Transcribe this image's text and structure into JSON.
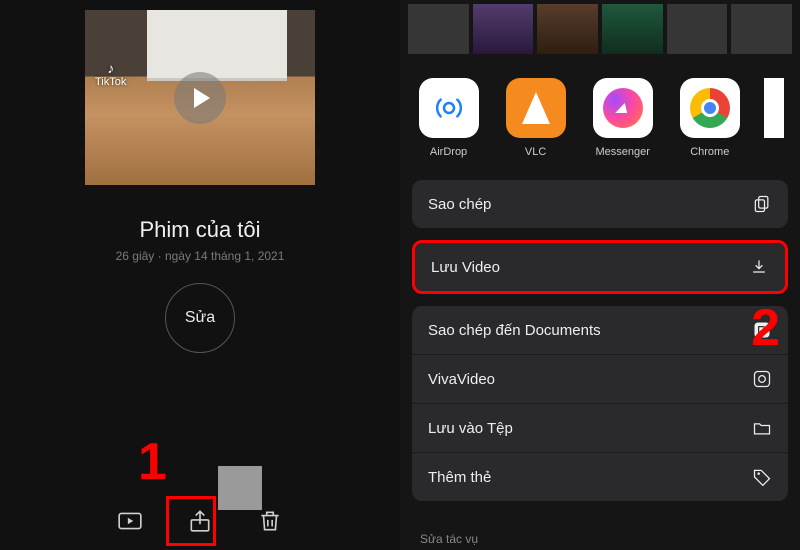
{
  "left": {
    "watermark": "TikTok",
    "title": "Phim của tôi",
    "subtitle": "26 giây · ngày 14 tháng 1, 2021",
    "edit_label": "Sửa"
  },
  "callouts": {
    "one": "1",
    "two": "2"
  },
  "share": {
    "apps": [
      {
        "name": "AirDrop"
      },
      {
        "name": "VLC"
      },
      {
        "name": "Messenger"
      },
      {
        "name": "Chrome"
      }
    ],
    "actions": {
      "copy": "Sao chép",
      "save_video": "Lưu Video",
      "copy_to_docs": "Sao chép đến Documents",
      "vivavideo": "VivaVideo",
      "save_to_files": "Lưu vào Tệp",
      "add_tags": "Thêm thẻ"
    },
    "footer": "Sửa tác vụ"
  }
}
